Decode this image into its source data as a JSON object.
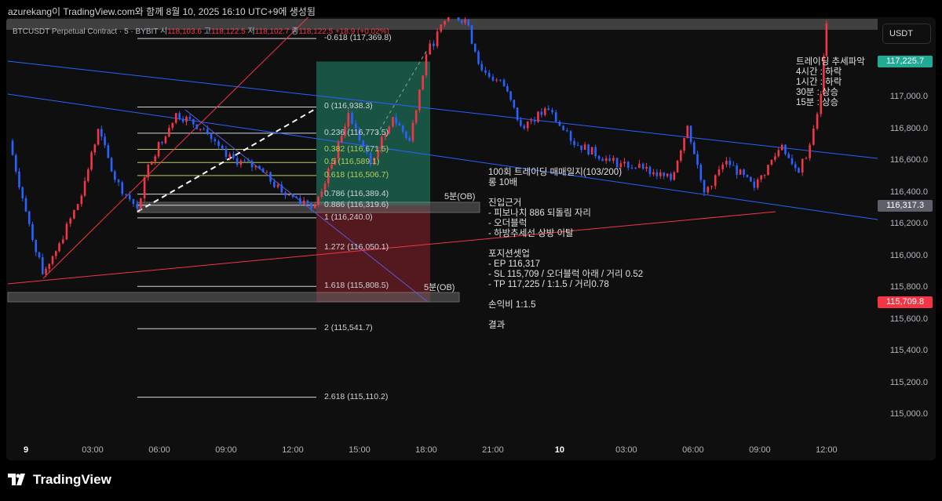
{
  "caption": "azurekang이 TradingView.com와 함께 8월 10, 2025 16:10 UTC+9에 생성됨",
  "legend": {
    "symbol": "BTCUSDT Perpetual Contract · 5 · BYBIT",
    "o_label": "시",
    "o": "118,103.6",
    "h_label": "고",
    "h": "118,122.5",
    "l_label": "저",
    "l": "118,102.7",
    "c_label": "종",
    "c": "118,122.5",
    "chg": "+18.9 (+0.02%)"
  },
  "currency": "USDT",
  "brand": "TradingView",
  "colors": {
    "up": "#f23645",
    "down": "#2962ff",
    "tp_zone": "#1e6b55",
    "sl_zone": "#6b1e24",
    "tp_badge": "#22ab94",
    "sl_badge": "#f23645",
    "last_badge": "#5d606b"
  },
  "price_badges": [
    {
      "label": "117,225.7",
      "price": 117225.7,
      "kind": "tp"
    },
    {
      "label": "116,317.3",
      "price": 116317.3,
      "kind": "last"
    },
    {
      "label": "115,709.8",
      "price": 115709.8,
      "kind": "sl"
    }
  ],
  "ob_labels": [
    "5분(OB)",
    "5분(OB)"
  ],
  "notes": {
    "trend": "트레이딩 추세파악\n4시간 : 하락\n1시간 : 하락\n30분 : 상승\n15분 : 상승",
    "journal": "100회 트레이딩 매매일지(103/200)\n롱 10배\n\n진입근거\n- 피보나치 886 되돌림 자리\n- 오더블럭\n- 하방추세선 상방 이탈\n\n포지션셋업\n- EP 116,317\n- SL 115,709 / 오더블럭 아래 / 거리 0.52\n- TP 117,225 / 1:1.5 / 거리0.78\n\n손익비 1:1.5\n\n결과"
  },
  "chart_data": {
    "type": "candlestick",
    "ylim": [
      114900,
      117600
    ],
    "y_ticks": [
      {
        "v": 117000,
        "label": "117,000.0"
      },
      {
        "v": 116800,
        "label": "116,800.0"
      },
      {
        "v": 116600,
        "label": "116,600.0"
      },
      {
        "v": 116400,
        "label": "116,400.0"
      },
      {
        "v": 116200,
        "label": "116,200.0"
      },
      {
        "v": 116000,
        "label": "116,000.0"
      },
      {
        "v": 115800,
        "label": "115,800.0"
      },
      {
        "v": 115600,
        "label": "115,600.0"
      },
      {
        "v": 115400,
        "label": "115,400.0"
      },
      {
        "v": 115200,
        "label": "115,200.0"
      },
      {
        "v": 115000,
        "label": "115,000.0"
      }
    ],
    "x_ticks": [
      {
        "h": 0,
        "label": "9",
        "bold": true
      },
      {
        "h": 3,
        "label": "03:00"
      },
      {
        "h": 6,
        "label": "06:00"
      },
      {
        "h": 9,
        "label": "09:00"
      },
      {
        "h": 12,
        "label": "12:00"
      },
      {
        "h": 15,
        "label": "15:00"
      },
      {
        "h": 18,
        "label": "18:00"
      },
      {
        "h": 21,
        "label": "21:00"
      },
      {
        "h": 24,
        "label": "10",
        "bold": true
      },
      {
        "h": 27,
        "label": "03:00"
      },
      {
        "h": 30,
        "label": "06:00"
      },
      {
        "h": 33,
        "label": "09:00"
      },
      {
        "h": 36,
        "label": "12:00"
      }
    ],
    "price_path": [
      {
        "t": "2025-08-08 23:15",
        "p": 116725
      },
      {
        "t": "2025-08-09 00:00",
        "p": 116280
      },
      {
        "t": "2025-08-09 00:45",
        "p": 115885
      },
      {
        "t": "2025-08-09 01:30",
        "p": 116080
      },
      {
        "t": "2025-08-09 02:30",
        "p": 116380
      },
      {
        "t": "2025-08-09 03:15",
        "p": 116800
      },
      {
        "t": "2025-08-09 04:00",
        "p": 116480
      },
      {
        "t": "2025-08-09 05:00",
        "p": 116300
      },
      {
        "t": "2025-08-09 05:30",
        "p": 116575
      },
      {
        "t": "2025-08-09 06:45",
        "p": 116900
      },
      {
        "t": "2025-08-09 08:00",
        "p": 116800
      },
      {
        "t": "2025-08-09 09:00",
        "p": 116625
      },
      {
        "t": "2025-08-09 10:30",
        "p": 116550
      },
      {
        "t": "2025-08-09 11:30",
        "p": 116400
      },
      {
        "t": "2025-08-09 13:00",
        "p": 116320
      },
      {
        "t": "2025-08-09 13:45",
        "p": 116575
      },
      {
        "t": "2025-08-09 14:30",
        "p": 116900
      },
      {
        "t": "2025-08-09 15:30",
        "p": 116575
      },
      {
        "t": "2025-08-09 16:30",
        "p": 116875
      },
      {
        "t": "2025-08-09 17:15",
        "p": 116725
      },
      {
        "t": "2025-08-09 18:00",
        "p": 117270
      },
      {
        "t": "2025-08-09 19:00",
        "p": 117515
      },
      {
        "t": "2025-08-09 19:45",
        "p": 117490
      },
      {
        "t": "2025-08-09 20:30",
        "p": 117170
      },
      {
        "t": "2025-08-09 21:30",
        "p": 117070
      },
      {
        "t": "2025-08-09 22:15",
        "p": 116820
      },
      {
        "t": "2025-08-09 23:30",
        "p": 116920
      },
      {
        "t": "2025-08-10 00:30",
        "p": 116725
      },
      {
        "t": "2025-08-10 02:15",
        "p": 116600
      },
      {
        "t": "2025-08-10 03:45",
        "p": 116550
      },
      {
        "t": "2025-08-10 05:00",
        "p": 116480
      },
      {
        "t": "2025-08-10 05:45",
        "p": 116820
      },
      {
        "t": "2025-08-10 06:30",
        "p": 116400
      },
      {
        "t": "2025-08-10 07:30",
        "p": 116600
      },
      {
        "t": "2025-08-10 08:45",
        "p": 116430
      },
      {
        "t": "2025-08-10 10:00",
        "p": 116700
      },
      {
        "t": "2025-08-10 10:45",
        "p": 116525
      },
      {
        "t": "2025-08-10 11:15",
        "p": 116700
      },
      {
        "t": "2025-08-10 11:45",
        "p": 117020
      },
      {
        "t": "2025-08-10 12:00",
        "p": 117465
      }
    ],
    "fib_levels": [
      {
        "label": "-0.618 (117,369.8)",
        "price": 117369.8,
        "color": "#d1d4dc"
      },
      {
        "label": "0 (116,938.3)",
        "price": 116938.3,
        "color": "#d1d4dc"
      },
      {
        "label": "0.236 (116,773.5)",
        "price": 116773.5,
        "color": "#d1d4dc"
      },
      {
        "label": "0.382 (116,671.5)",
        "price": 116671.5,
        "color": "#b6cf5a"
      },
      {
        "label": "0.5 (116,589.1)",
        "price": 116589.1,
        "color": "#b6cf5a"
      },
      {
        "label": "0.618 (116,506.7)",
        "price": 116506.7,
        "color": "#b6cf5a"
      },
      {
        "label": "0.786 (116,389.4)",
        "price": 116389.4,
        "color": "#d1d4dc"
      },
      {
        "label": "0.886 (116,319.6)",
        "price": 116319.6,
        "color": "#d1d4dc"
      },
      {
        "label": "1 (116,240.0)",
        "price": 116240.0,
        "color": "#d1d4dc"
      },
      {
        "label": "1.272 (116,050.1)",
        "price": 116050.1,
        "color": "#d1d4dc"
      },
      {
        "label": "1.618 (115,808.5)",
        "price": 115808.5,
        "color": "#d1d4dc"
      },
      {
        "label": "2 (115,541.7)",
        "price": 115541.7,
        "color": "#d1d4dc"
      },
      {
        "label": "2.618 (115,110.2)",
        "price": 115110.2,
        "color": "#d1d4dc"
      }
    ],
    "position": {
      "entry": 116317,
      "stop": 115709,
      "target": 117225
    }
  }
}
